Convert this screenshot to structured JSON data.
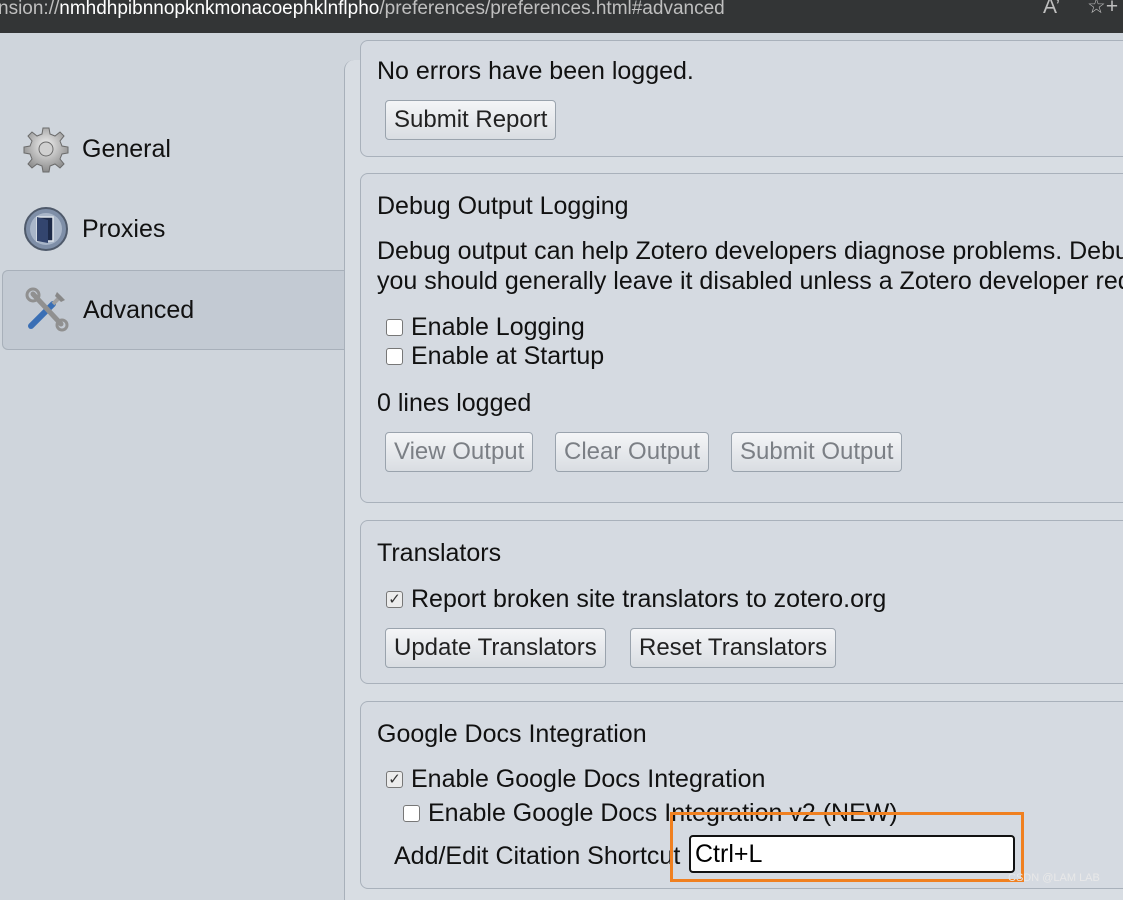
{
  "browser": {
    "url_prefix": "nsion://",
    "url_host": "nmhdhpibnnopknkmonacoephklnflpho",
    "url_path": "/preferences/preferences.html#advanced",
    "read_aloud_icon": "A’",
    "favorite_icon": "☆+"
  },
  "sidebar": {
    "items": [
      {
        "label": "General",
        "icon": "gear-icon"
      },
      {
        "label": "Proxies",
        "icon": "proxy-door-icon"
      },
      {
        "label": "Advanced",
        "icon": "tools-icon",
        "selected": true
      }
    ]
  },
  "error_report": {
    "status": "No errors have been logged.",
    "submit_label": "Submit Report"
  },
  "debug": {
    "title": "Debug Output Logging",
    "desc_line1": "Debug output can help Zotero developers diagnose problems. Debu",
    "desc_line2": "you should generally leave it disabled unless a Zotero developer req",
    "enable_logging": "Enable Logging",
    "enable_startup": "Enable at Startup",
    "lines_logged": "0 lines logged",
    "view_output": "View Output",
    "clear_output": "Clear Output",
    "submit_output": "Submit Output"
  },
  "translators": {
    "title": "Translators",
    "report_broken": "Report broken site translators to zotero.org",
    "update_label": "Update Translators",
    "reset_label": "Reset Translators"
  },
  "gdocs": {
    "title": "Google Docs Integration",
    "enable": "Enable Google Docs Integration",
    "enable_v2": "Enable Google Docs Integration v2 (NEW)",
    "shortcut_label": "Add/Edit Citation Shortcut",
    "shortcut_value": "Ctrl+L"
  },
  "watermark": "CSDN @LAM LAB",
  "colors": {
    "highlight": "#f08020",
    "background": "#cfd5dc"
  }
}
